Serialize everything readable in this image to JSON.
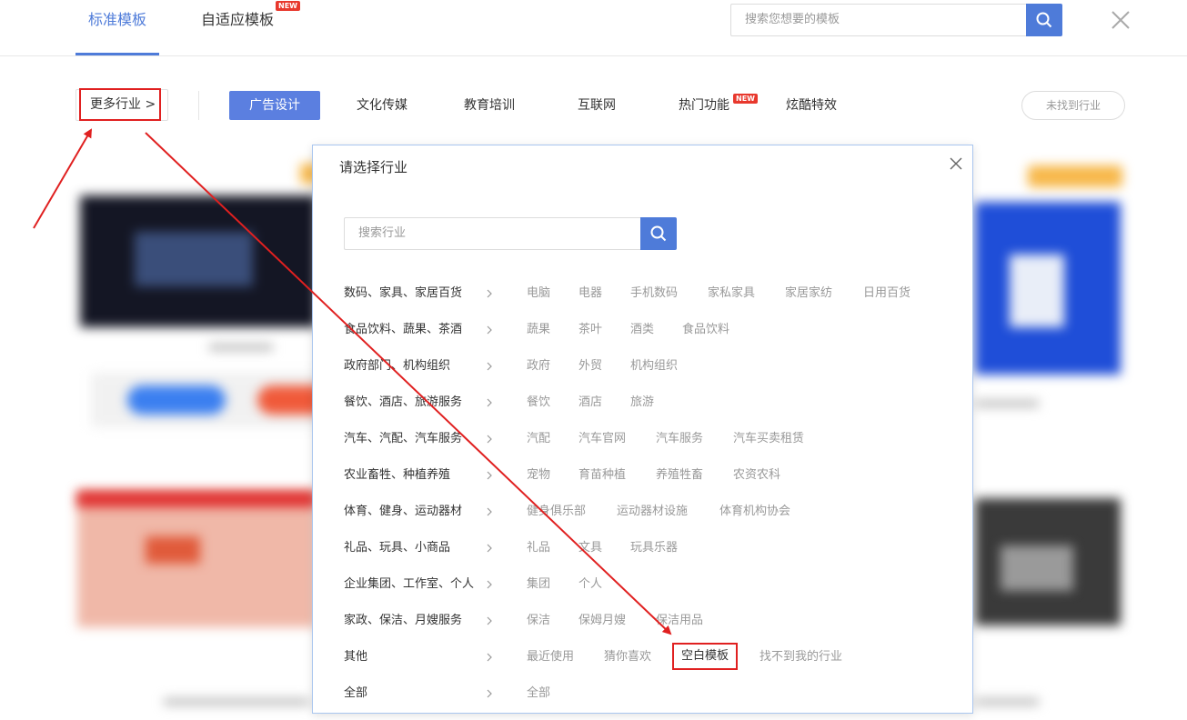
{
  "header": {
    "tabs": [
      {
        "label": "标准模板"
      },
      {
        "label": "自适应模板",
        "badge": "NEW"
      }
    ],
    "search_placeholder": "搜索您想要的模板"
  },
  "categories": {
    "more_label": "更多行业 >",
    "items": [
      "广告设计",
      "文化传媒",
      "教育培训",
      "互联网",
      "热门功能",
      "炫酷特效"
    ],
    "hot_badge": "NEW",
    "not_found_label": "未找到行业"
  },
  "modal": {
    "title": "请选择行业",
    "search_placeholder": "搜索行业",
    "industries": [
      {
        "name": "数码、家具、家居百货",
        "subs": [
          "电脑",
          "电器",
          "手机数码",
          "家私家具",
          "家居家纺",
          "日用百货"
        ]
      },
      {
        "name": "食品饮料、蔬果、茶酒",
        "subs": [
          "蔬果",
          "茶叶",
          "酒类",
          "食品饮料"
        ]
      },
      {
        "name": "政府部门、机构组织",
        "subs": [
          "政府",
          "外贸",
          "机构组织"
        ]
      },
      {
        "name": "餐饮、酒店、旅游服务",
        "subs": [
          "餐饮",
          "酒店",
          "旅游"
        ]
      },
      {
        "name": "汽车、汽配、汽车服务",
        "subs": [
          "汽配",
          "汽车官网",
          "汽车服务",
          "汽车买卖租赁"
        ]
      },
      {
        "name": "农业畜牲、种植养殖",
        "subs": [
          "宠物",
          "育苗种植",
          "养殖牲畜",
          "农资农科"
        ]
      },
      {
        "name": "体育、健身、运动器材",
        "subs": [
          "健身俱乐部",
          "运动器材设施",
          "体育机构协会"
        ]
      },
      {
        "name": "礼品、玩具、小商品",
        "subs": [
          "礼品",
          "文具",
          "玩具乐器"
        ]
      },
      {
        "name": "企业集团、工作室、个人",
        "subs": [
          "集团",
          "个人"
        ]
      },
      {
        "name": "家政、保洁、月嫂服务",
        "subs": [
          "保洁",
          "保姆月嫂",
          "保洁用品"
        ]
      },
      {
        "name": "其他",
        "subs": [
          "最近使用",
          "猜你喜欢",
          "空白模板",
          "找不到我的行业"
        ]
      },
      {
        "name": "全部",
        "subs": [
          "全部"
        ]
      }
    ]
  },
  "colors": {
    "accent": "#4e7bd9",
    "annotation_red": "#e02020",
    "badge_red": "#e8382d"
  }
}
